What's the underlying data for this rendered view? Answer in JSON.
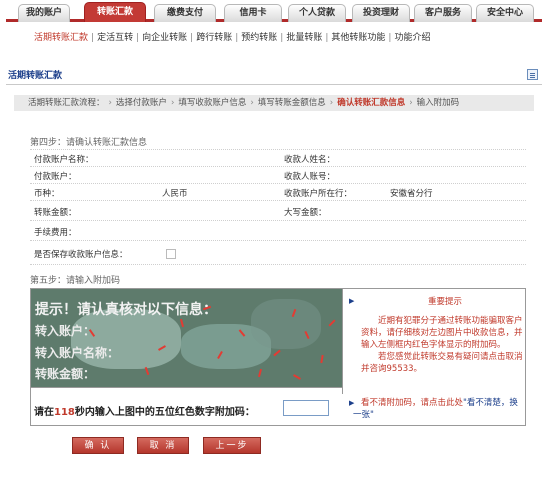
{
  "tabs": [
    {
      "label": "我的账户"
    },
    {
      "label": "转账汇款"
    },
    {
      "label": "缴费支付"
    },
    {
      "label": "信用卡"
    },
    {
      "label": "个人贷款"
    },
    {
      "label": "投资理财"
    },
    {
      "label": "客户服务"
    },
    {
      "label": "安全中心"
    }
  ],
  "subnav": [
    {
      "label": "活期转账汇款"
    },
    {
      "label": "定活互转"
    },
    {
      "label": "向企业转账"
    },
    {
      "label": "跨行转账"
    },
    {
      "label": "预约转账"
    },
    {
      "label": "批量转账"
    },
    {
      "label": "其他转账功能"
    },
    {
      "label": "功能介绍"
    }
  ],
  "page_title": "活期转账汇款",
  "flow": {
    "label": "活期转账汇款流程：",
    "steps": [
      "选择付款账户",
      "填写收款账户信息",
      "填写转账金额信息",
      "确认转账汇款信息",
      "输入附加码"
    ]
  },
  "step4": {
    "title": "第四步：请确认转账汇款信息",
    "payer_name_label": "付款账户名称：",
    "payee_name_label": "收款人姓名：",
    "payer_account_label": "付款账户：",
    "payee_account_label": "收款人账号：",
    "currency_label": "币种：",
    "currency_value": "人民币",
    "payee_branch_label": "收款账户所在行：",
    "payee_branch_value": "安徽省分行",
    "amount_label": "转账金额：",
    "amount_upper_label": "大写金额：",
    "fee_label": "手续费用：",
    "save_payee_label": "是否保存收款账户信息："
  },
  "step5": {
    "title": "第五步：请输入附加码",
    "captcha_lines": [
      "提示！请认真核对以下信息：",
      "转入账户：",
      "转入账户名称：",
      "转账金额："
    ],
    "warning_title": "重要提示",
    "warning_body": "近期有犯罪分子通过转账功能骗取客户资料，请仔细核对左边图片中收款信息，并输入左侧框内红色字体显示的附加码。",
    "warning_body2": "若您感觉此转账交易有疑问请点击取消并咨询95533。",
    "prompt_prefix": "请在",
    "prompt_seconds": "118",
    "prompt_suffix": "秒内输入上图中的五位红色数字附加码：",
    "hint_text": "看不清附加码，请点击此处",
    "hint_link": "\"看不清楚，换一张\""
  },
  "buttons": {
    "confirm": "确 认",
    "cancel": "取 消",
    "prev": "上一步"
  }
}
